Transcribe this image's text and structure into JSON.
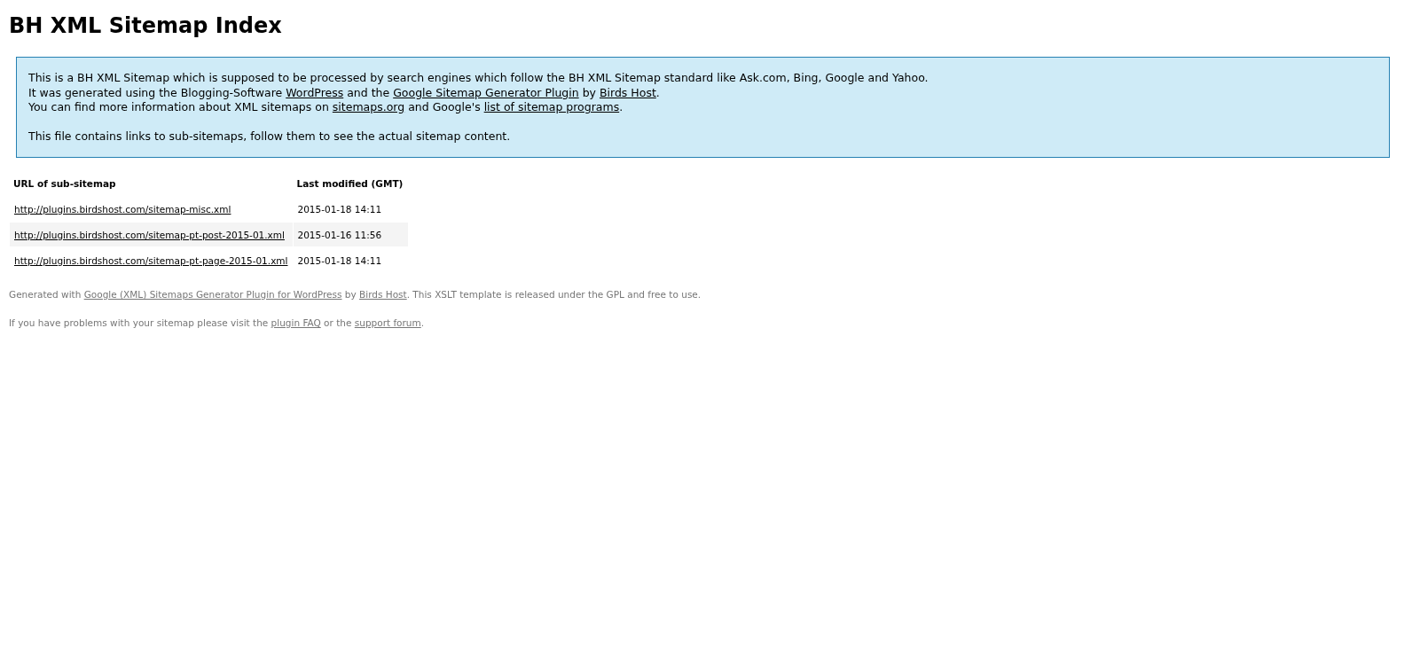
{
  "title": "BH XML Sitemap Index",
  "intro": {
    "lines": [
      [
        {
          "text": "This is a BH XML Sitemap which is supposed to be processed by search engines which follow the BH XML Sitemap standard like Ask.com, Bing, Google and Yahoo."
        }
      ],
      [
        {
          "text": "It was generated using the Blogging-Software "
        },
        {
          "link": "WordPress"
        },
        {
          "text": " and the "
        },
        {
          "link": "Google Sitemap Generator Plugin"
        },
        {
          "text": " by "
        },
        {
          "link": "Birds Host"
        },
        {
          "text": "."
        }
      ],
      [
        {
          "text": "You can find more information about XML sitemaps on "
        },
        {
          "link": "sitemaps.org"
        },
        {
          "text": " and Google's "
        },
        {
          "link": "list of sitemap programs"
        },
        {
          "text": "."
        }
      ]
    ],
    "note": "This file contains links to sub-sitemaps, follow them to see the actual sitemap content."
  },
  "table": {
    "columns": [
      "URL of sub-sitemap",
      "Last modified (GMT)"
    ],
    "rows": [
      {
        "url": "http://plugins.birdshost.com/sitemap-misc.xml",
        "modified": "2015-01-18 14:11"
      },
      {
        "url": "http://plugins.birdshost.com/sitemap-pt-post-2015-01.xml",
        "modified": "2015-01-16 11:56"
      },
      {
        "url": "http://plugins.birdshost.com/sitemap-pt-page-2015-01.xml",
        "modified": "2015-01-18 14:11"
      }
    ]
  },
  "footer": [
    [
      {
        "text": "Generated with "
      },
      {
        "link": "Google (XML) Sitemaps Generator Plugin for WordPress"
      },
      {
        "text": " by "
      },
      {
        "link": "Birds Host"
      },
      {
        "text": ". This XSLT template is released under the GPL and free to use."
      }
    ],
    [
      {
        "text": "If you have problems with your sitemap please visit the "
      },
      {
        "link": "plugin FAQ"
      },
      {
        "text": " or the "
      },
      {
        "link": "support forum"
      },
      {
        "text": "."
      }
    ]
  ]
}
